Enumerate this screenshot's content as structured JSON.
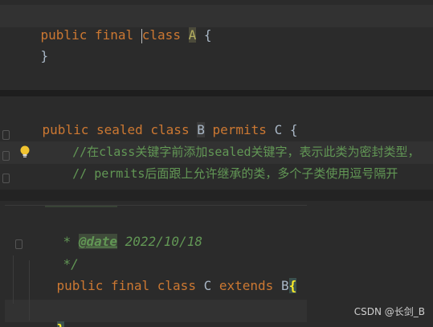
{
  "pane1": {
    "line1": {
      "kw1": "public",
      "kw2": "final",
      "kw3": "class",
      "name": "A",
      "brace": "{"
    },
    "line2": {
      "brace": "}"
    }
  },
  "pane2": {
    "line1": {
      "kw1": "public",
      "kw2": "sealed",
      "kw3": "class",
      "name": "B",
      "kw4": "permits",
      "perm": "C",
      "brace": "{"
    },
    "line2": {
      "comment": "//在class关键字前添加sealed关键字，表示此类为密封类型，"
    },
    "line3": {
      "comment": "// permits后面跟上允许继承的类，多个子类使用逗号隔开"
    },
    "line4": {
      "brace": "}"
    }
  },
  "pane3": {
    "line1": {
      "star": "*",
      "tag": "@date",
      "value": "2022/10/18"
    },
    "line2": {
      "end": "*/"
    },
    "line3": {
      "kw1": "public",
      "kw2": "final",
      "kw3": "class",
      "name": "C",
      "kw4": "extends",
      "parent": "B",
      "brace": "{"
    },
    "line5": {
      "brace": "}"
    }
  },
  "watermark": "CSDN @长剑_B",
  "colors": {
    "background": "#2b2b2b",
    "keyword": "#cc7832",
    "comment": "#629755",
    "text": "#a9b7c6",
    "brace_match": "#ffef28"
  },
  "icons": [
    "lightbulb-icon",
    "fold-marker-icon"
  ]
}
